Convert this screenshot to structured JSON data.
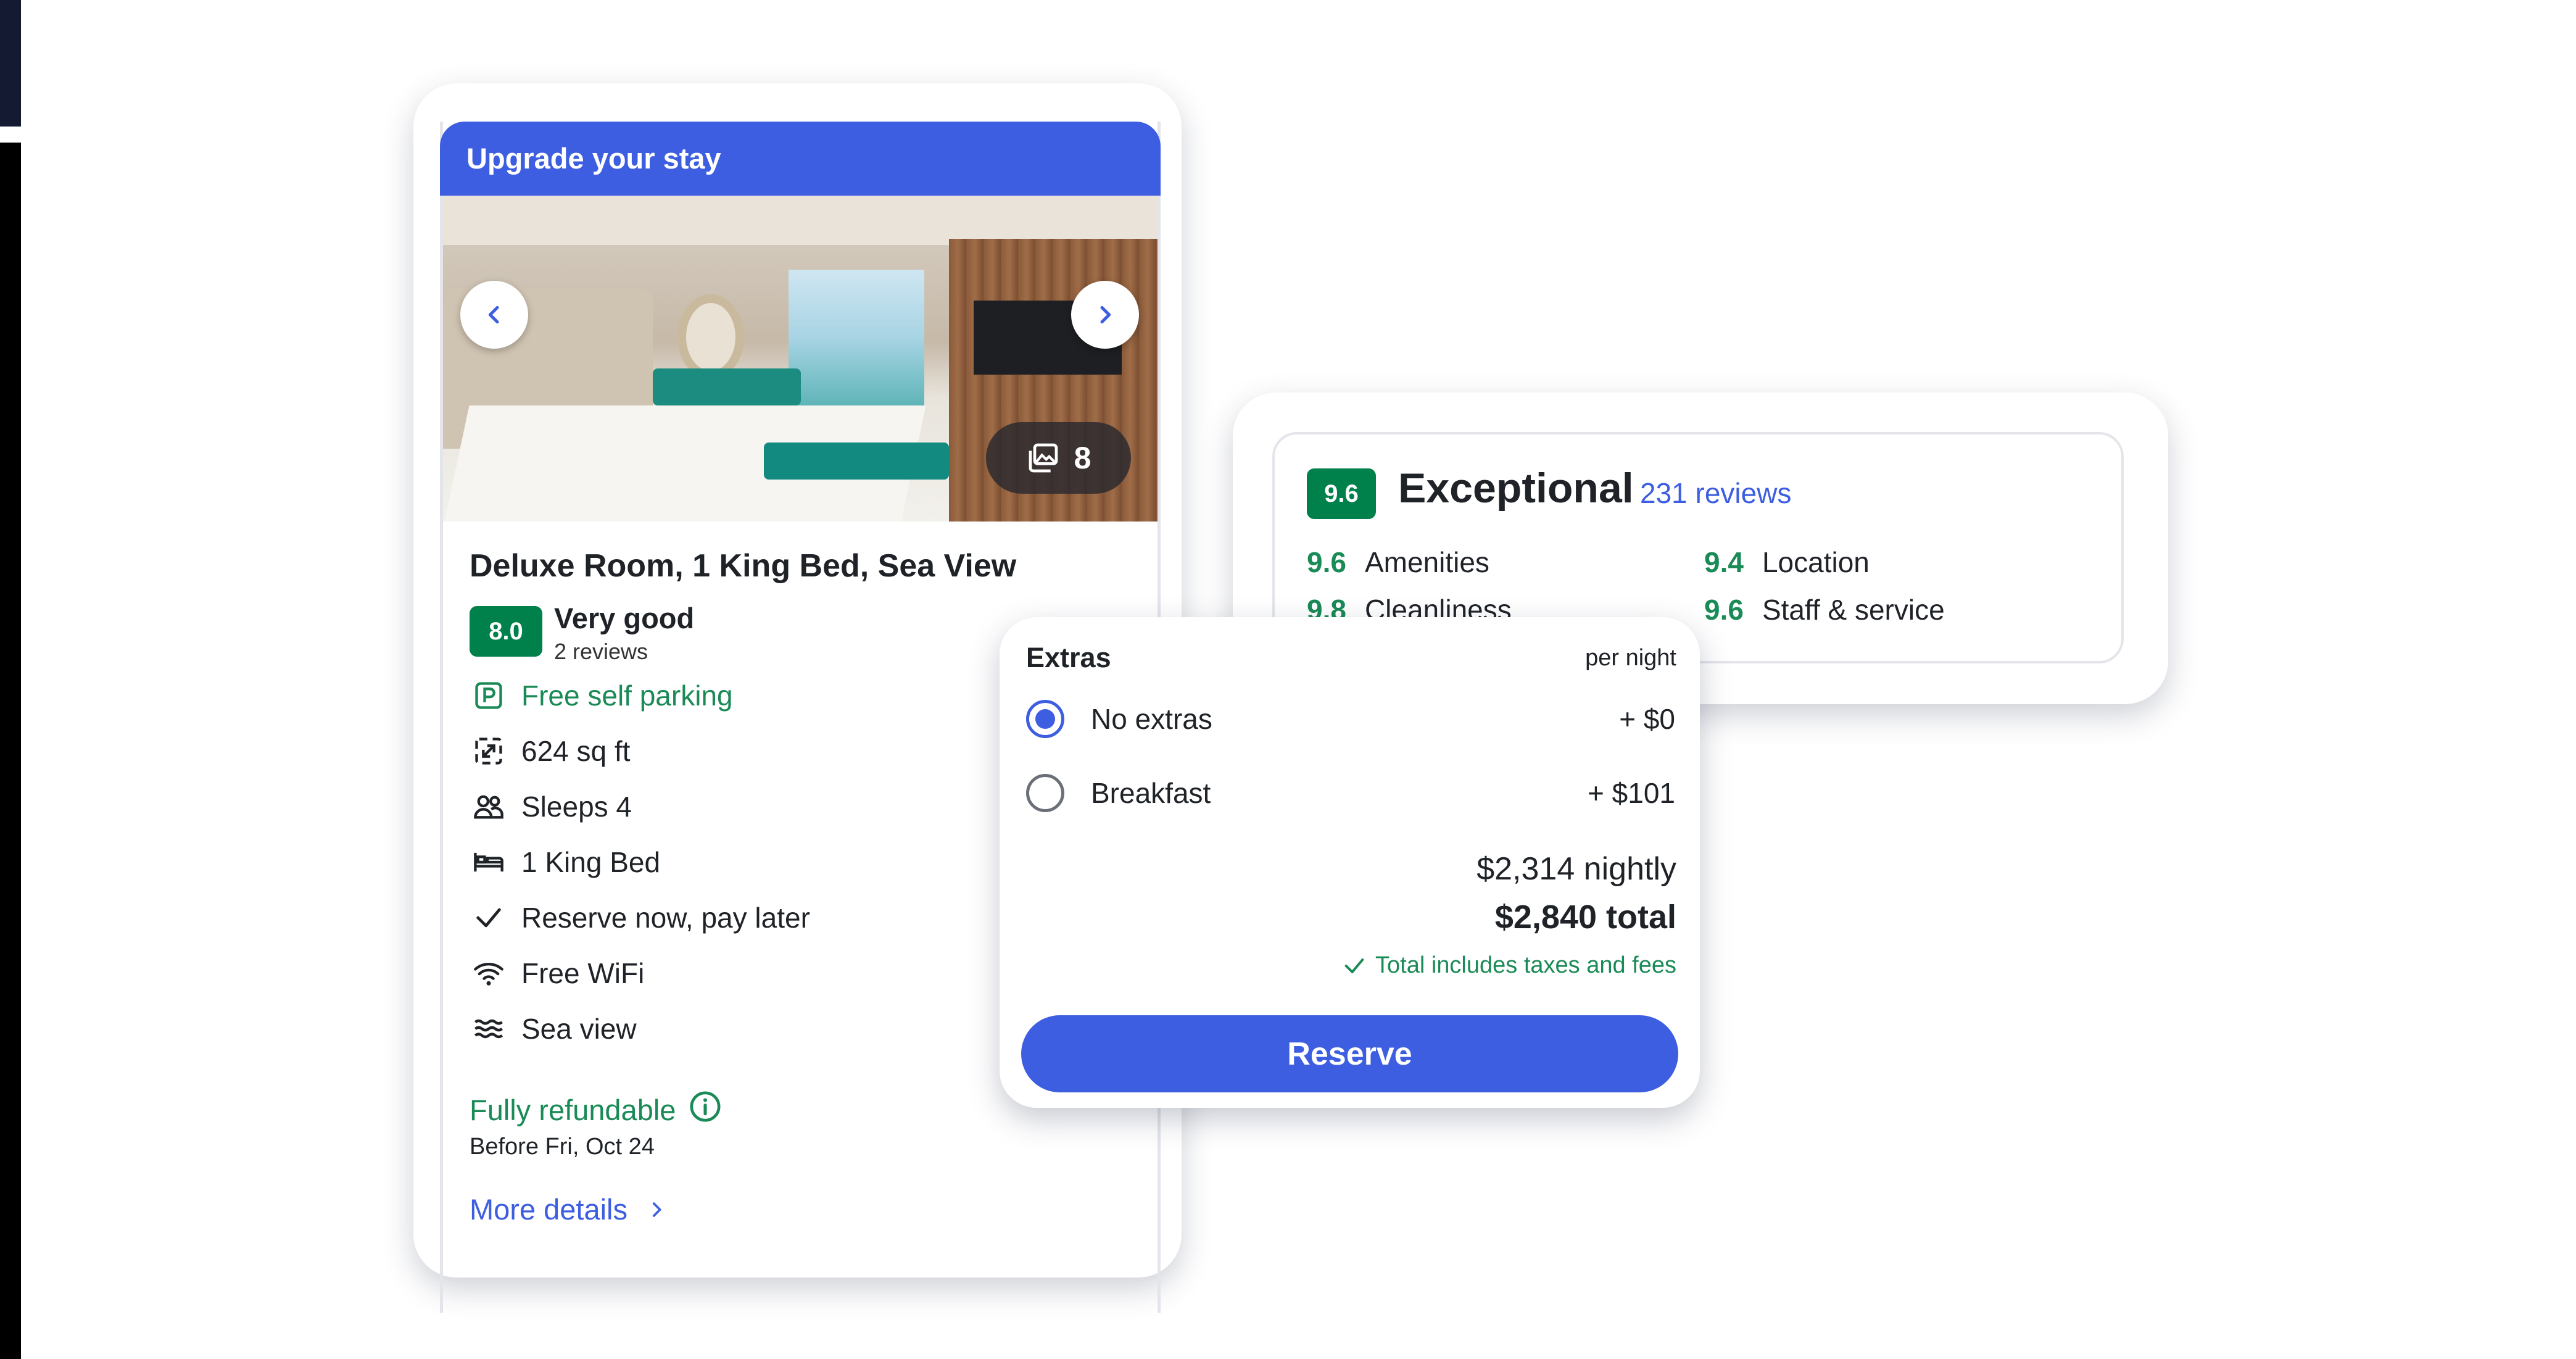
{
  "room": {
    "banner": "Upgrade your stay",
    "gallery_count": "8",
    "title": "Deluxe Room, 1 King Bed, Sea View",
    "rating_score": "8.0",
    "rating_label": "Very good",
    "rating_reviews": "2 reviews",
    "amenities": [
      {
        "icon": "parking-icon",
        "label": "Free self parking",
        "highlight": true
      },
      {
        "icon": "expand-icon",
        "label": "624 sq ft"
      },
      {
        "icon": "people-icon",
        "label": "Sleeps 4"
      },
      {
        "icon": "bed-icon",
        "label": "1 King Bed"
      },
      {
        "icon": "check-icon",
        "label": "Reserve now, pay later"
      },
      {
        "icon": "wifi-icon",
        "label": "Free WiFi"
      },
      {
        "icon": "waves-icon",
        "label": "Sea view"
      }
    ],
    "refund_label": "Fully refundable",
    "refund_date": "Before Fri, Oct 24",
    "more_details": "More details"
  },
  "reviews": {
    "score": "9.6",
    "label": "Exceptional",
    "count": "231 reviews",
    "subscores": [
      {
        "score": "9.6",
        "name": "Amenities"
      },
      {
        "score": "9.4",
        "name": "Location"
      },
      {
        "score": "9.8",
        "name": "Cleanliness"
      },
      {
        "score": "9.6",
        "name": "Staff & service"
      }
    ]
  },
  "extras": {
    "title": "Extras",
    "unit": "per night",
    "options": [
      {
        "label": "No extras",
        "price": "+ $0",
        "selected": true
      },
      {
        "label": "Breakfast",
        "price": "+ $101",
        "selected": false
      }
    ],
    "nightly": "$2,314 nightly",
    "total": "$2,840 total",
    "note": "Total includes taxes and fees",
    "reserve": "Reserve"
  },
  "colors": {
    "brand_blue": "#3d5ee0",
    "score_green": "#00804a",
    "text_green": "#1a8a56"
  }
}
